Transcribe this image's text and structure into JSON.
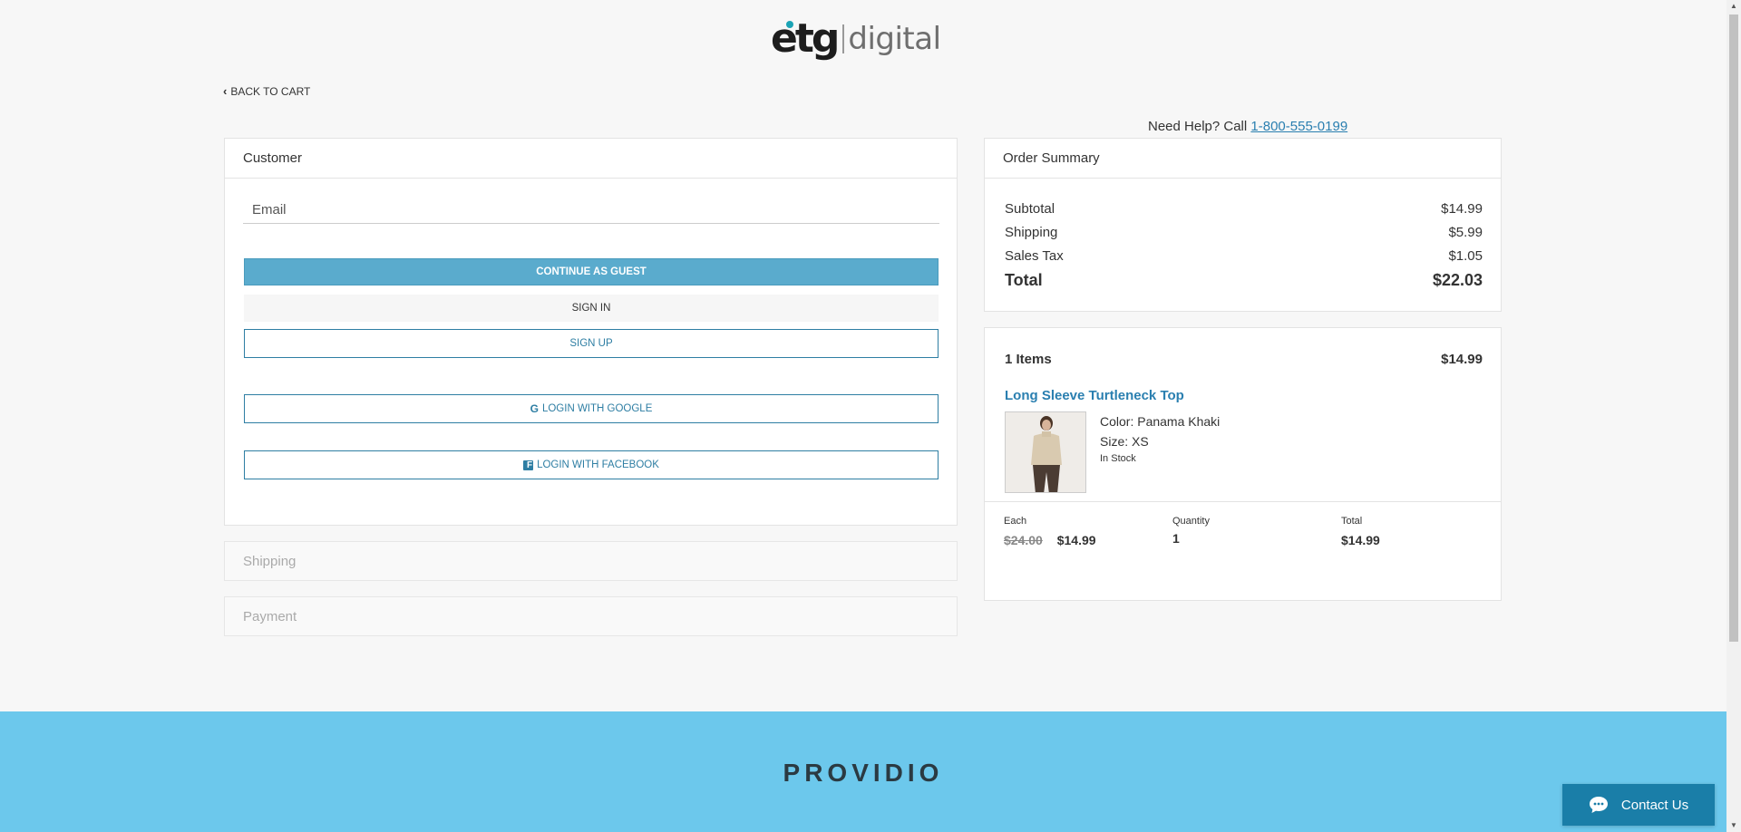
{
  "logo": {
    "brand": "etg",
    "suffix": "digital"
  },
  "nav": {
    "back_label": "BACK TO CART"
  },
  "help": {
    "prefix": "Need Help? Call ",
    "phone": "1-800-555-0199"
  },
  "customer": {
    "title": "Customer",
    "email_placeholder": "Email",
    "continue_guest": "CONTINUE AS GUEST",
    "sign_in": "SIGN IN",
    "sign_up": "SIGN UP",
    "login_google": "LOGIN WITH GOOGLE",
    "login_facebook": "LOGIN WITH FACEBOOK"
  },
  "sections": {
    "shipping": "Shipping",
    "payment": "Payment"
  },
  "summary": {
    "title": "Order Summary",
    "subtotal_label": "Subtotal",
    "subtotal": "$14.99",
    "shipping_label": "Shipping",
    "shipping": "$5.99",
    "tax_label": "Sales Tax",
    "tax": "$1.05",
    "total_label": "Total",
    "total": "$22.03"
  },
  "items": {
    "count_label": "1 Items",
    "count_total": "$14.99",
    "product": {
      "name": "Long Sleeve Turtleneck Top",
      "color": "Color: Panama Khaki",
      "size": "Size: XS",
      "stock": "In Stock",
      "each_label": "Each",
      "orig_price": "$24.00",
      "price": "$14.99",
      "qty_label": "Quantity",
      "qty": "1",
      "total_label": "Total",
      "total": "$14.99"
    }
  },
  "footer": {
    "brand": "PROVIDIO"
  },
  "chat": {
    "label": "Contact Us"
  },
  "colors": {
    "accent": "#5aabcd",
    "link": "#2a7fb0",
    "footer_bg": "#6cc8ec",
    "chat_bg": "#1a7ea8"
  }
}
